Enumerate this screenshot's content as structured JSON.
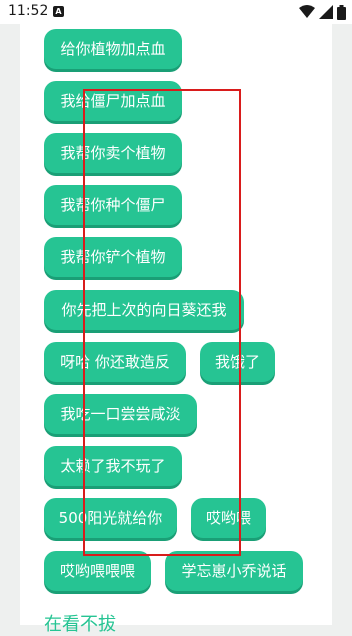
{
  "status": {
    "time": "11:52",
    "notification_icon": "A-badge-icon",
    "icons": [
      "wifi-icon",
      "signal-icon",
      "battery-icon"
    ]
  },
  "buttons": {
    "b1": "给你植物加点血",
    "b2": "我给僵尸加点血",
    "b3": "我帮你卖个植物",
    "b4": "我帮你种个僵尸",
    "b5": "我帮你铲个植物",
    "b6": "你先把上次的向日葵还我",
    "b7": "呀哈 你还敢造反",
    "b8": "我饿了",
    "b9": "我吃一口尝尝咸淡",
    "b10": "太赖了我不玩了",
    "b11": "500阳光就给你",
    "b12": "哎哟喂",
    "b13": "哎哟喂喂喂",
    "b14": "学忘崽小乔说话"
  },
  "next_section_title": "在看不拔",
  "colors": {
    "accent": "#26c493",
    "highlight_box": "#d91c1c"
  }
}
